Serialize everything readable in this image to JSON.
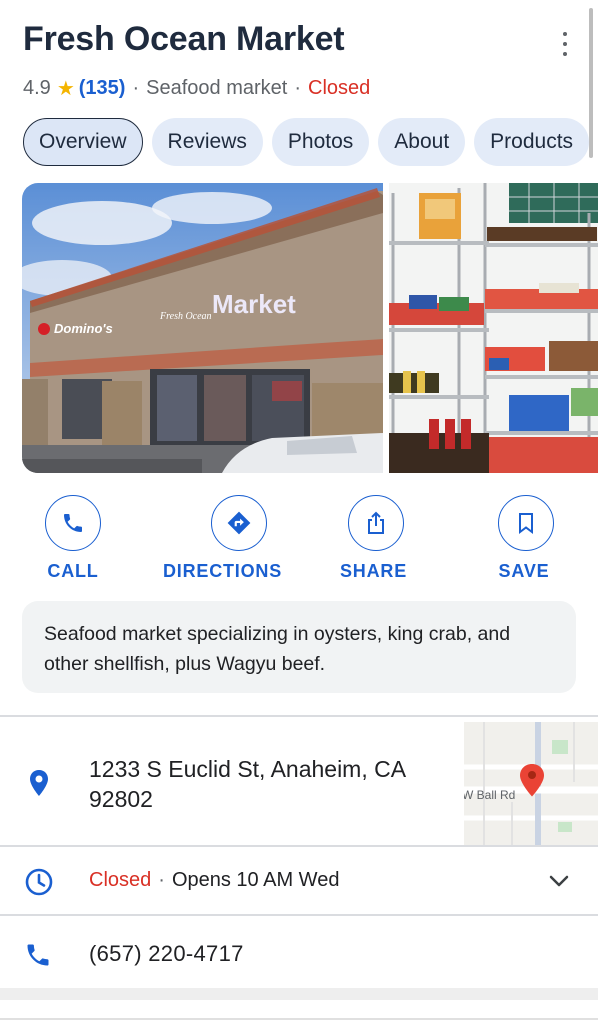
{
  "place": {
    "name": "Fresh Ocean Market",
    "rating": "4.9",
    "review_count": "(135)",
    "category": "Seafood market",
    "status": "Closed"
  },
  "tabs": [
    {
      "label": "Overview",
      "active": true
    },
    {
      "label": "Reviews"
    },
    {
      "label": "Photos"
    },
    {
      "label": "About"
    },
    {
      "label": "Products"
    }
  ],
  "photos": {
    "storefront_sign_left": "Domino's",
    "storefront_sign_right": "Market",
    "storefront_sign_script": "Fresh Ocean"
  },
  "actions": [
    {
      "label": "CALL",
      "icon": "phone-icon"
    },
    {
      "label": "DIRECTIONS",
      "icon": "directions-icon"
    },
    {
      "label": "SHARE",
      "icon": "share-icon"
    },
    {
      "label": "SAVE",
      "icon": "bookmark-icon"
    }
  ],
  "description": "Seafood market specializing in oysters, king crab, and other shellfish, plus Wagyu beef.",
  "info": {
    "address": "1233 S Euclid St, Anaheim, CA 92802",
    "map_road_label": "W Ball Rd",
    "hours_status": "Closed",
    "hours_next": "Opens 10 AM Wed",
    "phone": "(657) 220-4717"
  },
  "colors": {
    "accent": "#1a5fd0",
    "closed": "#d93025",
    "star": "#f4b400",
    "pin": "#ea4335"
  }
}
